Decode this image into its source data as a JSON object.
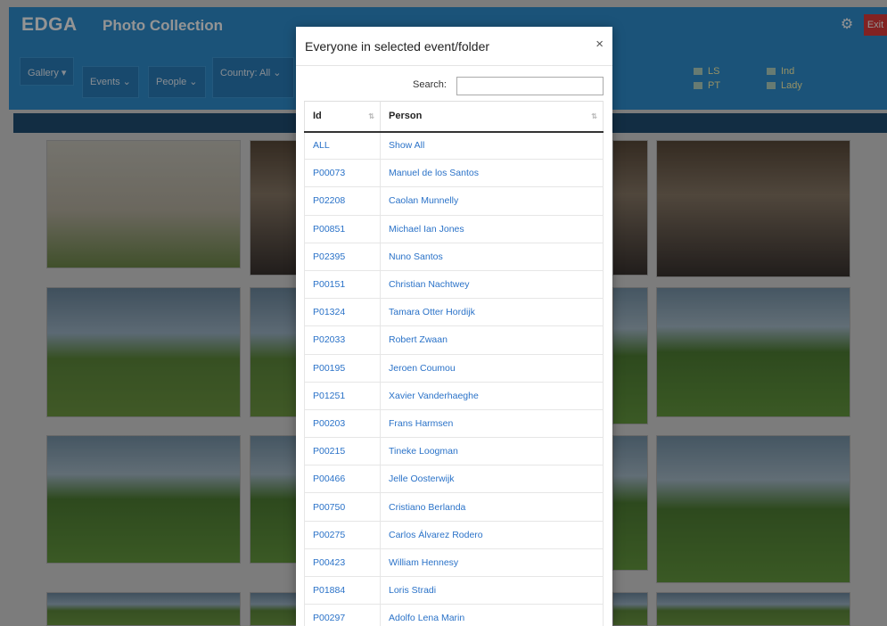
{
  "app": {
    "brand": "EDGA",
    "title": "Photo Collection",
    "exit_label": "Exit"
  },
  "filters": {
    "gallery": "Gallery ▾",
    "events": "Events ⌄",
    "people": "People ⌄",
    "country": "Country: All ⌄",
    "tags": [
      "LS",
      "PT",
      "Ind",
      "Lady"
    ]
  },
  "modal": {
    "title": "Everyone in selected event/folder",
    "close": "×",
    "search_label": "Search:",
    "search_value": "",
    "columns": [
      "Id",
      "Person"
    ],
    "rows": [
      {
        "id": "ALL",
        "person": "Show All"
      },
      {
        "id": "P00073",
        "person": "Manuel de los Santos"
      },
      {
        "id": "P02208",
        "person": "Caolan Munnelly"
      },
      {
        "id": "P00851",
        "person": "Michael Ian Jones"
      },
      {
        "id": "P02395",
        "person": "Nuno Santos"
      },
      {
        "id": "P00151",
        "person": "Christian Nachtwey"
      },
      {
        "id": "P01324",
        "person": "Tamara Otter Hordijk"
      },
      {
        "id": "P02033",
        "person": "Robert Zwaan"
      },
      {
        "id": "P00195",
        "person": "Jeroen Coumou"
      },
      {
        "id": "P01251",
        "person": "Xavier Vanderhaeghe"
      },
      {
        "id": "P00203",
        "person": "Frans Harmsen"
      },
      {
        "id": "P00215",
        "person": "Tineke Loogman"
      },
      {
        "id": "P00466",
        "person": "Jelle Oosterwijk"
      },
      {
        "id": "P00750",
        "person": "Cristiano Berlanda"
      },
      {
        "id": "P00275",
        "person": "Carlos Álvarez Rodero"
      },
      {
        "id": "P00423",
        "person": "William Hennesy"
      },
      {
        "id": "P01884",
        "person": "Loris Stradi"
      },
      {
        "id": "P00297",
        "person": "Adolfo Lena Marin"
      }
    ]
  },
  "colors": {
    "brand_blue": "#2f8fd0",
    "link_blue": "#2a72c8",
    "exit_red": "#e03b3b"
  }
}
